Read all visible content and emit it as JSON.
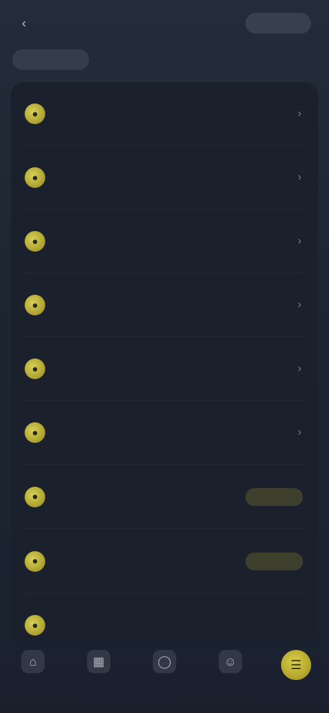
{
  "header": {
    "title": "",
    "right_pill": ""
  },
  "section": {
    "chip_label": ""
  },
  "list": {
    "items": [
      {
        "label": "",
        "sub": "",
        "badge": ""
      },
      {
        "label": "",
        "sub": "",
        "badge": ""
      },
      {
        "label": "",
        "sub": "",
        "badge": ""
      },
      {
        "label": "",
        "sub": "",
        "badge": ""
      },
      {
        "label": "",
        "sub": "",
        "badge": ""
      },
      {
        "label": "",
        "sub": "",
        "badge": ""
      },
      {
        "label": "",
        "sub": "",
        "badge": ""
      },
      {
        "label": "",
        "sub": "",
        "badge": ""
      },
      {
        "label": "",
        "sub": "",
        "badge": ""
      }
    ]
  },
  "bottom_nav": {
    "items": [
      {
        "label": "",
        "icon": "home-icon"
      },
      {
        "label": "",
        "icon": "grid-icon"
      },
      {
        "label": "",
        "icon": "circle-icon"
      },
      {
        "label": "",
        "icon": "user-icon"
      },
      {
        "label": "",
        "icon": "menu-icon"
      }
    ],
    "active_index": 4
  },
  "colors": {
    "accent": "#c9bb3a",
    "background": "#1f2733",
    "card": "#1a202c"
  }
}
